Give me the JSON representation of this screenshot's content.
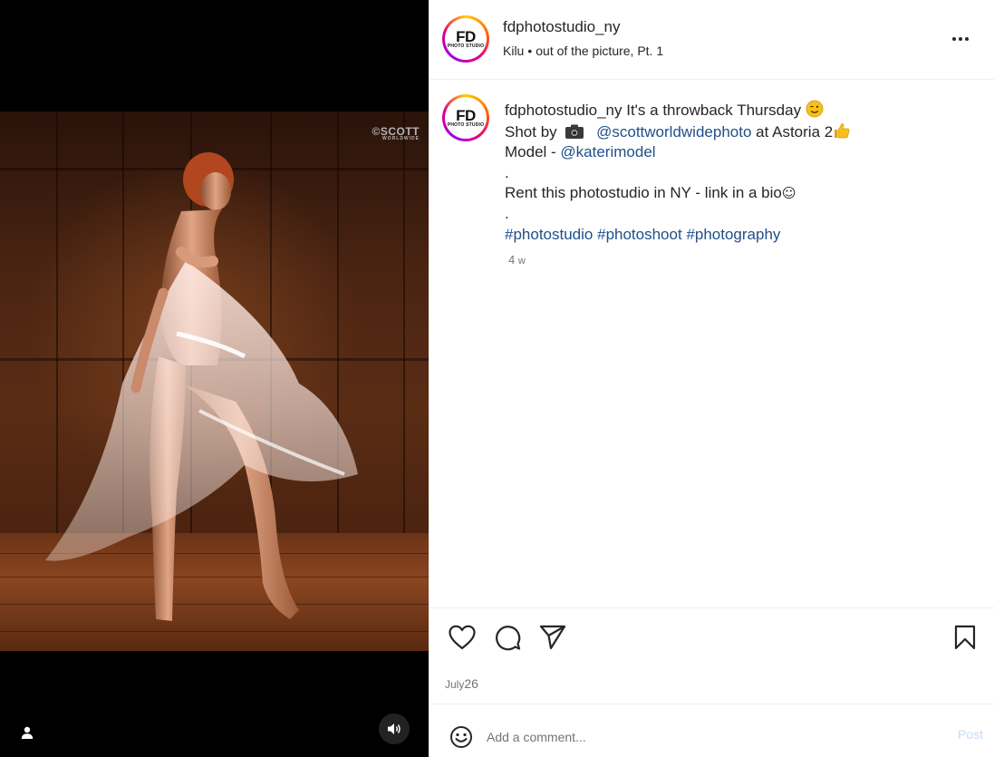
{
  "media": {
    "watermark_main": "©SCOTT",
    "watermark_sub": "WORLDWIDE",
    "icons": {
      "user": "user-tag-icon",
      "sound": "speaker-icon"
    }
  },
  "header": {
    "avatar_text": "FD",
    "avatar_subtext": "PHOTO STUDIO",
    "username": "fdphotostudio_ny",
    "audio_artist": "Kilu",
    "audio_separator": "•",
    "audio_title": "out of the picture, Pt. 1"
  },
  "caption": {
    "username": "fdphotostudio_ny",
    "line1_text": "It's a throwback Thursday",
    "line2_prefix": "Shot by",
    "line2_mention": "@scottworldwidephoto",
    "line2_suffix": "at Astoria 2",
    "line3_prefix": "Model -",
    "line3_mention": "@katerimodel",
    "dot1": ".",
    "line5_text": "Rent this photostudio in NY - link in a bio",
    "line5_emoji": "☺",
    "dot2": ".",
    "hashtags": [
      "#photostudio",
      "#photoshoot",
      "#photography"
    ],
    "time_num": "4",
    "time_unit": "w"
  },
  "actions": {
    "icons": [
      "heart-icon",
      "comment-bubble-icon",
      "send-icon",
      "bookmark-icon"
    ],
    "date_month": "July",
    "date_day": "26"
  },
  "comment_bar": {
    "placeholder": "Add a comment...",
    "post_label": "Post",
    "post_color": "#c6dcf5"
  },
  "colors": {
    "link": "#1f4f8a",
    "muted": "#737373",
    "text": "#262626"
  }
}
